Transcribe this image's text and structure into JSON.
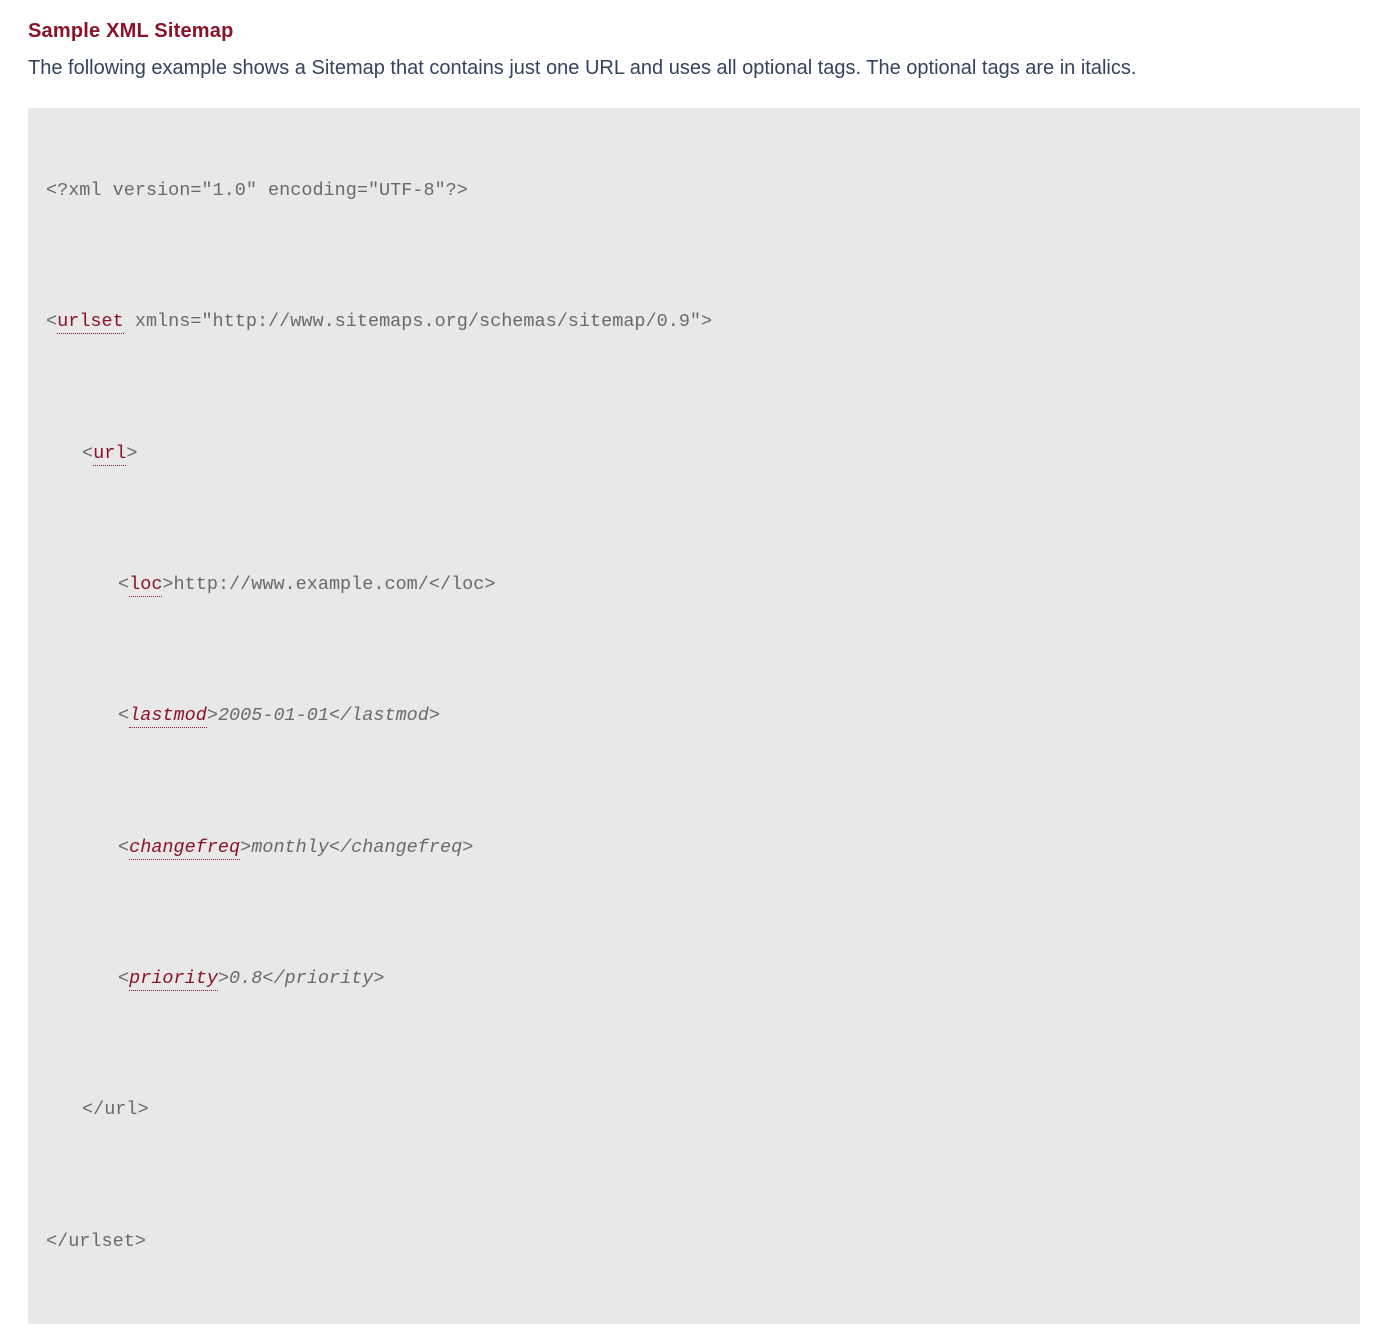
{
  "heading": "Sample XML Sitemap",
  "intro": "The following example shows a Sitemap that contains just one URL and uses all optional tags. The optional tags are in italics.",
  "code": {
    "line1": "<?xml version=\"1.0\" encoding=\"UTF-8\"?>",
    "urlset_open_prefix": "<",
    "urlset_tag": "urlset",
    "urlset_attrs": " xmlns=\"http://www.sitemaps.org/schemas/sitemap/0.9\">",
    "url_open_prefix": "<",
    "url_tag": "url",
    "url_open_suffix": ">",
    "loc_open_prefix": "<",
    "loc_tag": "loc",
    "loc_open_suffix": ">",
    "loc_value": "http://www.example.com/",
    "loc_close": "</loc>",
    "lastmod_open_prefix": "<",
    "lastmod_tag": "lastmod",
    "lastmod_open_suffix": ">",
    "lastmod_value": "2005-01-01",
    "lastmod_close": "</lastmod>",
    "changefreq_open_prefix": "<",
    "changefreq_tag": "changefreq",
    "changefreq_open_suffix": ">",
    "changefreq_value": "monthly",
    "changefreq_close": "</changefreq>",
    "priority_open_prefix": "<",
    "priority_tag": "priority",
    "priority_open_suffix": ">",
    "priority_value": "0.8",
    "priority_close": "</priority>",
    "url_close": "</url>",
    "urlset_close": "</urlset>"
  }
}
